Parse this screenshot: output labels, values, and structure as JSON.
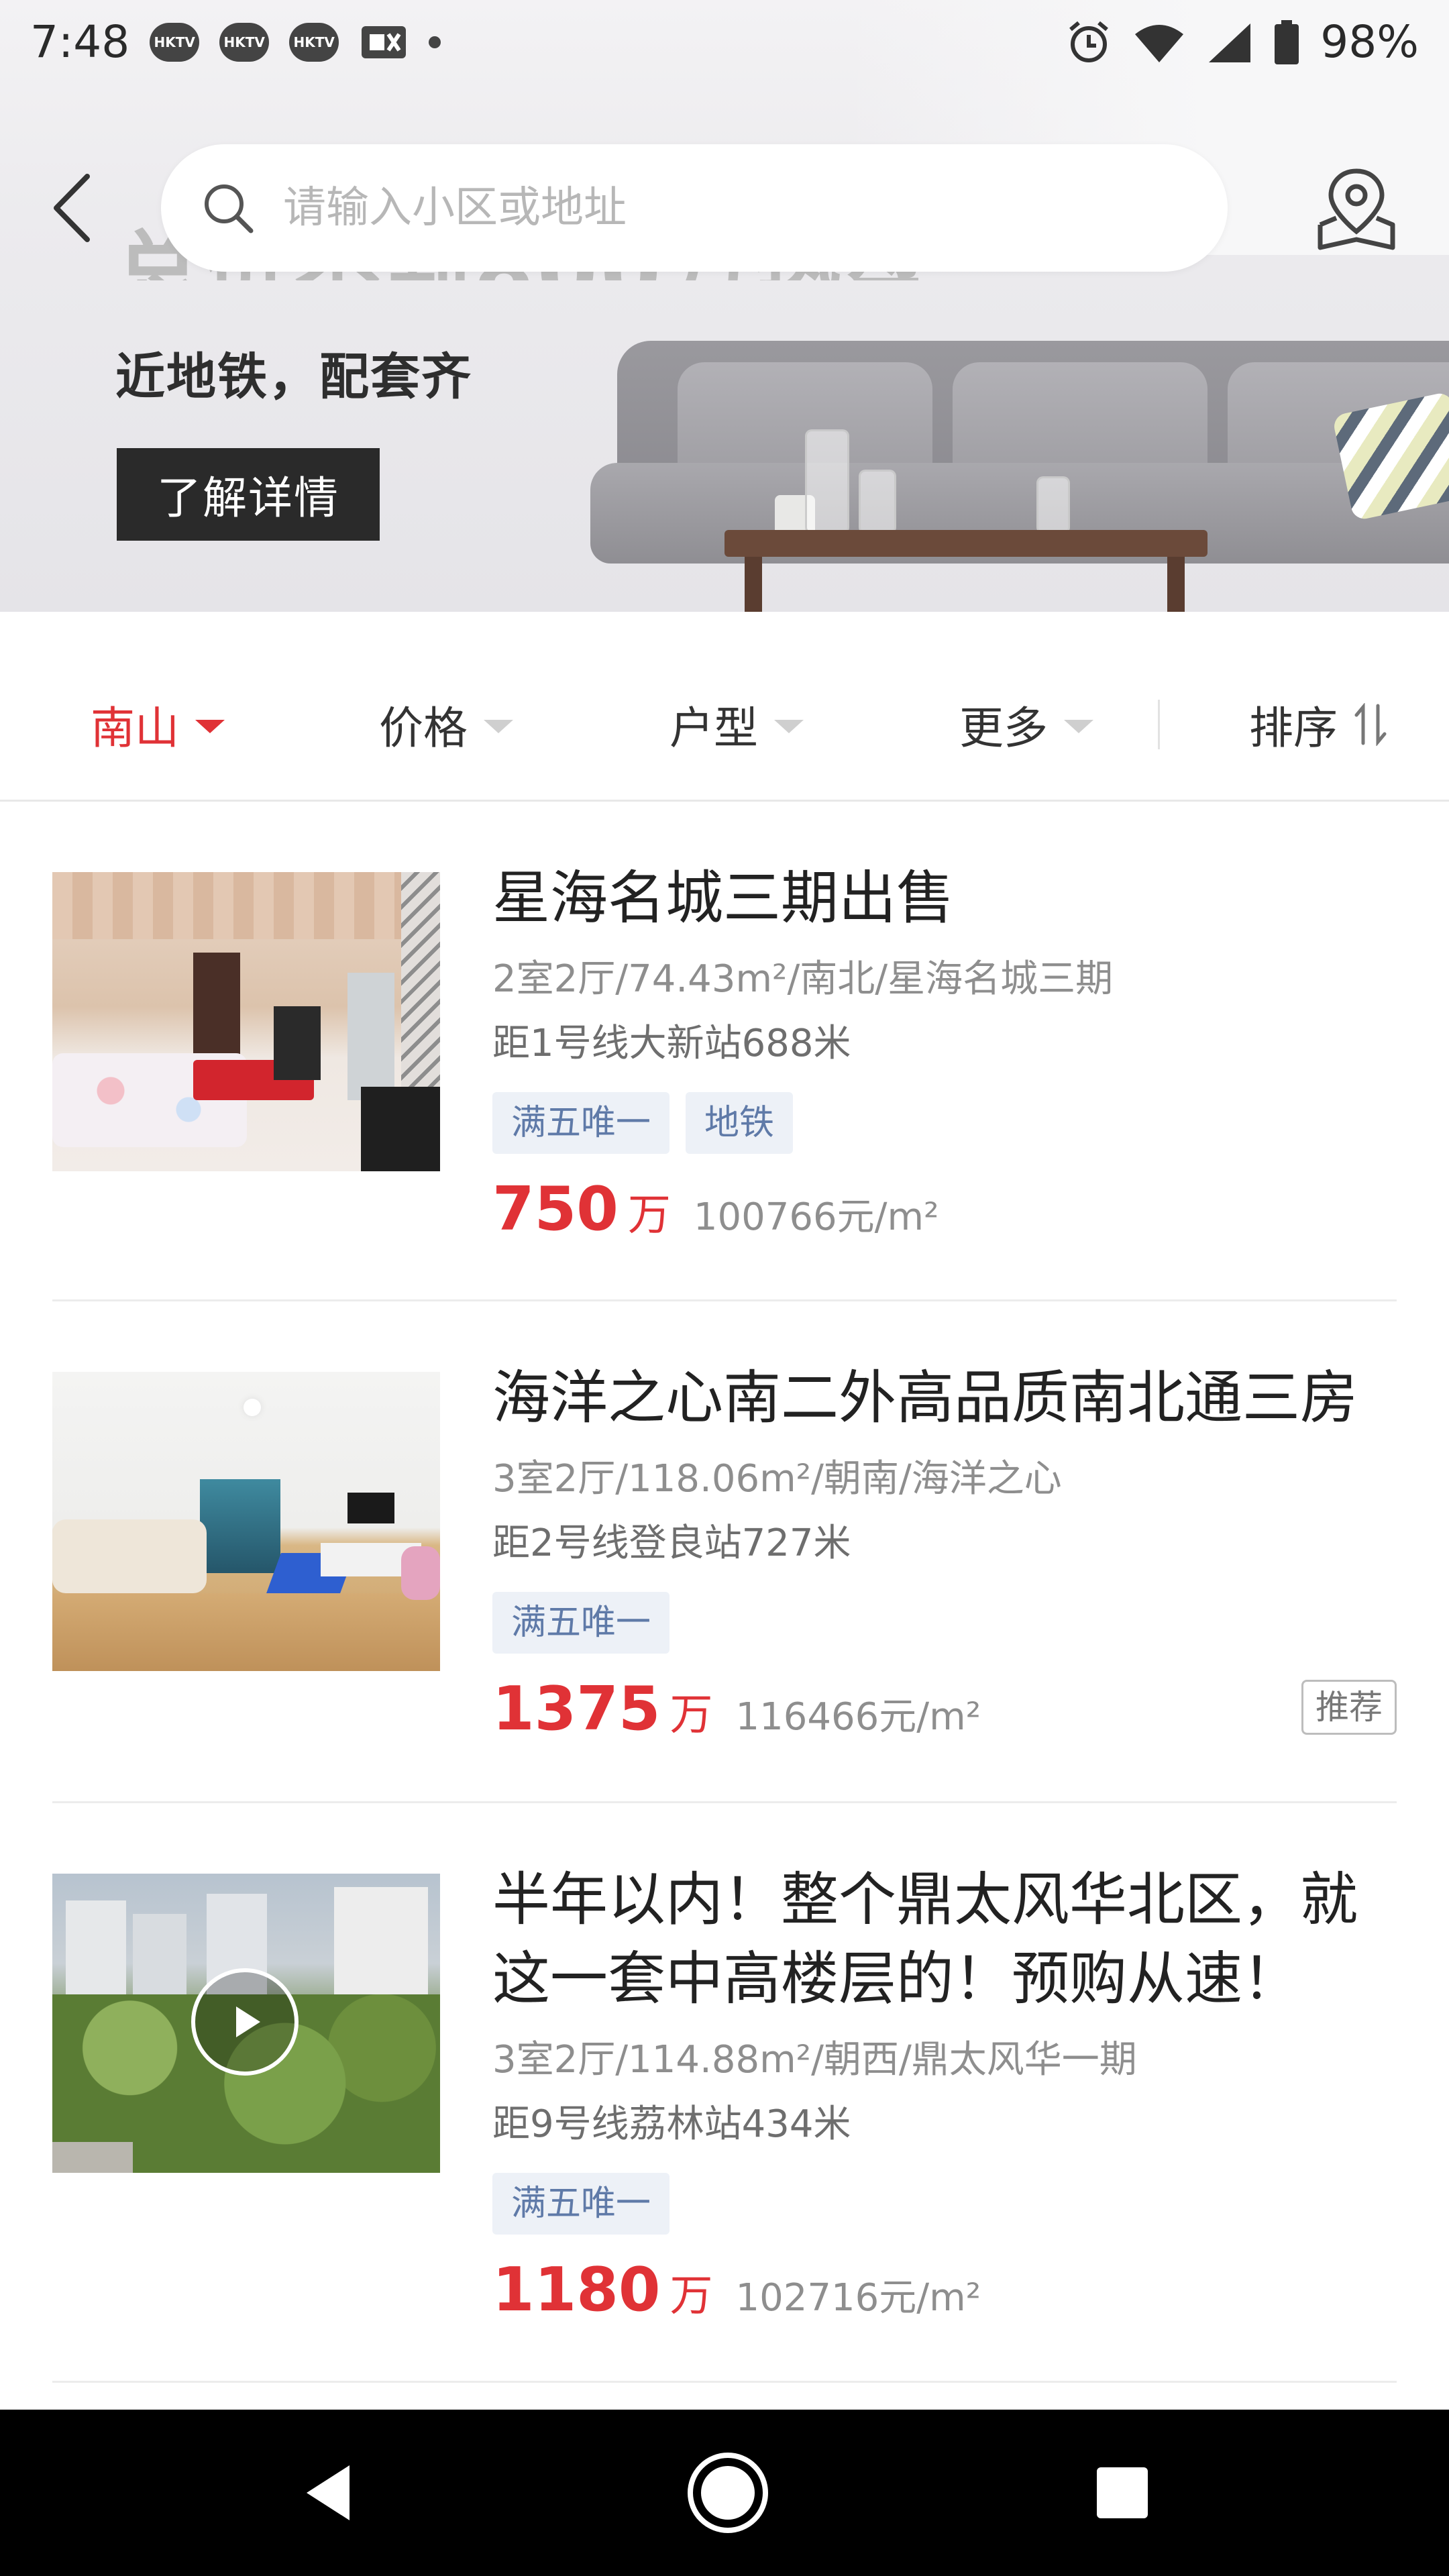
{
  "status_bar": {
    "time": "7:48",
    "notifications": [
      "HKTV",
      "HKTV",
      "HKTV"
    ],
    "battery": "98%"
  },
  "banner": {
    "headline": "总价不到800万热盘",
    "subtitle": "近地铁，配套齐",
    "button_label": "了解详情"
  },
  "search": {
    "placeholder": "请输入小区或地址"
  },
  "filters": {
    "district": "南山",
    "price": "价格",
    "layout": "户型",
    "more": "更多",
    "sort": "排序"
  },
  "listings": [
    {
      "title": "星海名城三期出售",
      "meta": "2室2厅/74.43m²/南北/星海名城三期",
      "distance": "距1号线大新站688米",
      "tags": [
        "满五唯一",
        "地铁"
      ],
      "price": "750",
      "price_unit": "万",
      "price_per_m2": "100766元/m²"
    },
    {
      "title": "海洋之心南二外高品质南北通三房",
      "meta": "3室2厅/118.06m²/朝南/海洋之心",
      "distance": "距2号线登良站727米",
      "tags": [
        "满五唯一"
      ],
      "price": "1375",
      "price_unit": "万",
      "price_per_m2": "116466元/m²",
      "badge": "推荐"
    },
    {
      "title": "半年以内！整个鼎太风华北区，就这一套中高楼层的！预购从速！",
      "meta": "3室2厅/114.88m²/朝西/鼎太风华一期",
      "distance": "距9号线荔林站434米",
      "tags": [
        "满五唯一"
      ],
      "price": "1180",
      "price_unit": "万",
      "price_per_m2": "102716元/m²"
    }
  ],
  "colors": {
    "accent": "#e03236",
    "tag_bg": "#edf1f7",
    "tag_text": "#5f7aa8"
  }
}
